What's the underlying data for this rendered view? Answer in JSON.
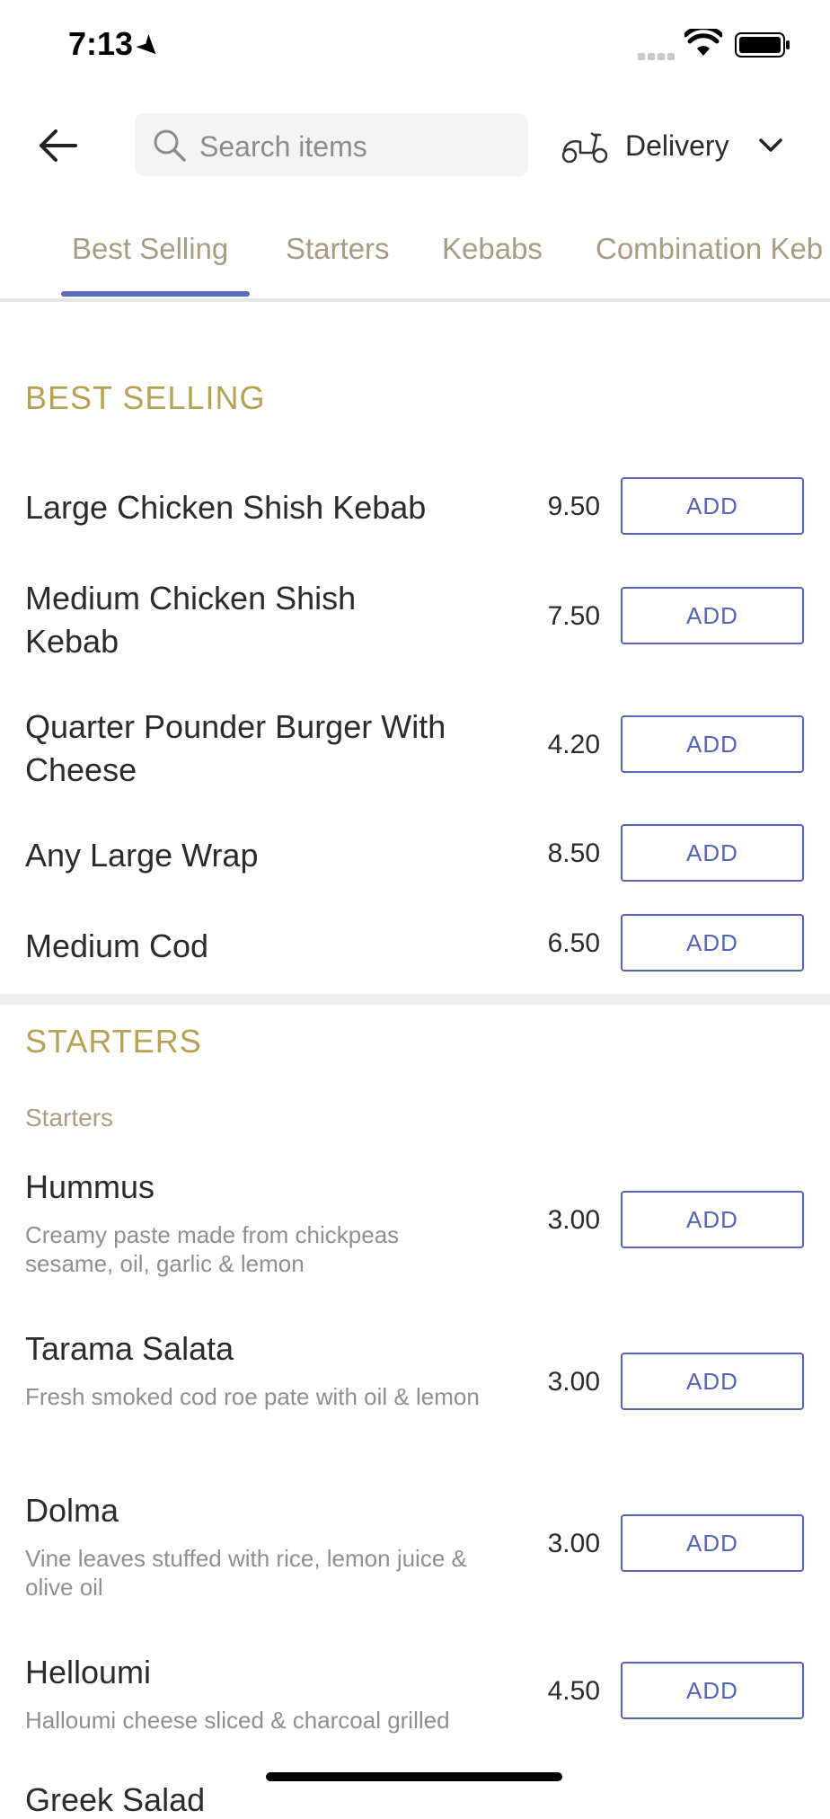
{
  "status_bar": {
    "time": "7:13"
  },
  "header": {
    "search_placeholder": "Search items",
    "delivery_label": "Delivery"
  },
  "tabs": [
    {
      "label": "Best Selling"
    },
    {
      "label": "Starters"
    },
    {
      "label": "Kebabs"
    },
    {
      "label": "Combination Keb"
    }
  ],
  "sections": {
    "best_selling": {
      "title": "BEST SELLING",
      "items": [
        {
          "name": "Large Chicken Shish Kebab",
          "price": "9.50",
          "button": "ADD"
        },
        {
          "name": "Medium Chicken Shish Kebab",
          "price": "7.50",
          "button": "ADD"
        },
        {
          "name": "Quarter Pounder Burger With Cheese",
          "price": "4.20",
          "button": "ADD"
        },
        {
          "name": "Any Large Wrap",
          "price": "8.50",
          "button": "ADD"
        },
        {
          "name": "Medium Cod",
          "price": "6.50",
          "button": "ADD"
        }
      ]
    },
    "starters": {
      "title": "STARTERS",
      "subtitle": "Starters",
      "items": [
        {
          "name": "Hummus",
          "desc": "Creamy paste made from chickpeas sesame, oil, garlic & lemon",
          "price": "3.00",
          "button": "ADD"
        },
        {
          "name": "Tarama Salata",
          "desc": "Fresh smoked cod roe pate with oil & lemon",
          "price": "3.00",
          "button": "ADD"
        },
        {
          "name": "Dolma",
          "desc": "Vine leaves stuffed with rice, lemon juice & olive oil",
          "price": "3.00",
          "button": "ADD"
        },
        {
          "name": "Helloumi",
          "desc": "Halloumi cheese sliced & charcoal grilled",
          "price": "4.50",
          "button": "ADD"
        }
      ],
      "cut_off_item": "Greek Salad"
    }
  },
  "colors": {
    "accent_blue": "#5464b8",
    "section_gold": "#b6a256",
    "tab_text": "#a79c83"
  }
}
